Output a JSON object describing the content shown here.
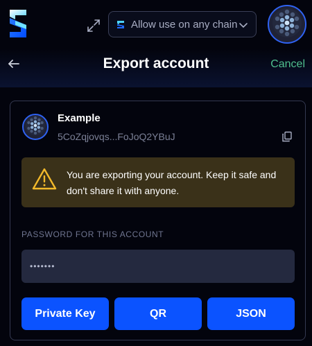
{
  "topbar": {
    "chain_select_label": "Allow use on any chain"
  },
  "header": {
    "title": "Export account",
    "cancel_label": "Cancel"
  },
  "account": {
    "name": "Example",
    "address": "5CoZqjovqs...FoJoQ2YBuJ"
  },
  "warning": {
    "text": "You are exporting your account. Keep it safe and don't share it with anyone."
  },
  "password": {
    "label": "PASSWORD FOR THIS ACCOUNT",
    "value": "•••••••"
  },
  "actions": {
    "private_key_label": "Private Key",
    "qr_label": "QR",
    "json_label": "JSON"
  },
  "colors": {
    "background": "#03040d",
    "accent_blue": "#0b53ff",
    "cancel_green": "#4fbf8e",
    "warning_bg": "#3a3119",
    "warning_icon": "#f2b92b"
  }
}
